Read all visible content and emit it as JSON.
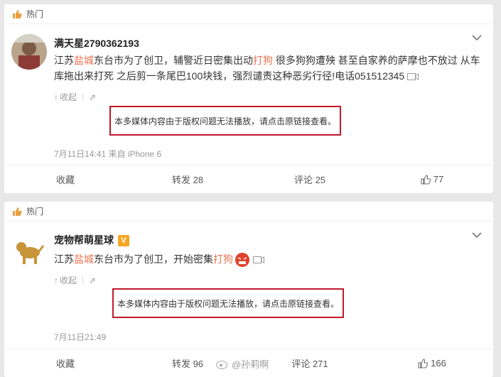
{
  "posts": [
    {
      "hot_label": "热门",
      "username": "满天星2790362193",
      "verified": false,
      "text_parts": [
        "江苏",
        "盐城",
        "东台市为了创卫，辅警近日密集出动",
        "打狗",
        " 很多狗狗遭殃 甚至自家养的萨摩也不放过 从车",
        "库拖出来打死 之后剪一条尾巴100块钱，强烈谴责这种恶劣行径!电话051512345"
      ],
      "collapse_label": "收起",
      "notice": "本多媒体内容由于版权问题无法播放，请点击原链接查看。",
      "timestamp": "7月11日14:41 来自 iPhone 6",
      "actions": {
        "favorite": "收藏",
        "repost": "转发 28",
        "comment": "评论 25",
        "like": "77"
      }
    },
    {
      "hot_label": "热门",
      "username": "宠物帮萌星球",
      "verified": true,
      "verified_mark": "V",
      "text_parts": [
        "江苏",
        "盐城",
        "东台市为了创卫，开始密集",
        "打狗"
      ],
      "collapse_label": "收起",
      "notice": "本多媒体内容由于版权问题无法播放，请点击原链接查看。",
      "timestamp": "7月11日21:49",
      "actions": {
        "favorite": "收藏",
        "repost": "转发 96",
        "comment": "评论 271",
        "like": "166"
      }
    }
  ],
  "watermark": "@孙莉啊",
  "colors": {
    "highlight": "#eb7350",
    "notice_border": "#c0192b",
    "badge": "#f5a623"
  }
}
